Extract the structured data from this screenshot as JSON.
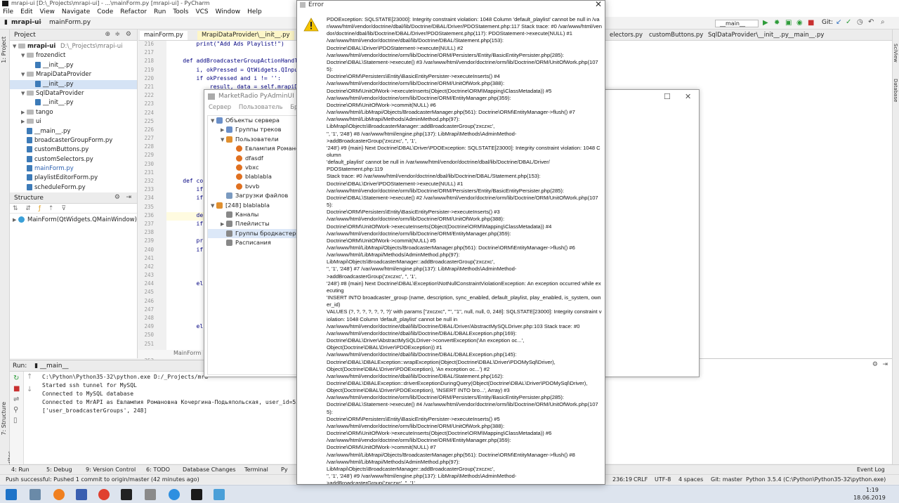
{
  "ide": {
    "title": "mrapi-ui [D:\\_Projects\\mrapi-ui] - ...\\mainForm.py [mrapi-ui] - PyCharm",
    "menu": [
      "File",
      "Edit",
      "View",
      "Navigate",
      "Code",
      "Refactor",
      "Run",
      "Tools",
      "VCS",
      "Window",
      "Help"
    ],
    "breadcrumb_project": "mrapi-ui",
    "breadcrumb_file": "mainForm.py",
    "run_config": "__main__",
    "git_label": "Git:"
  },
  "project_panel": {
    "title": "Project",
    "root": "mrapi-ui",
    "root_path": "D:\\_Projects\\mrapi-ui",
    "items": [
      {
        "label": "frozendict",
        "type": "folder"
      },
      {
        "label": "__init__.py",
        "type": "file"
      },
      {
        "label": "MrapiDataProvider",
        "type": "folder"
      },
      {
        "label": "__init__.py",
        "type": "file"
      },
      {
        "label": "SqlDataProvider",
        "type": "folder"
      },
      {
        "label": "__init__.py",
        "type": "file"
      },
      {
        "label": "tango",
        "type": "folder"
      },
      {
        "label": "ui",
        "type": "folder"
      },
      {
        "label": "__main__.py",
        "type": "file"
      },
      {
        "label": "broadcasterGroupForm.py",
        "type": "file"
      },
      {
        "label": "customButtons.py",
        "type": "file"
      },
      {
        "label": "customSelectors.py",
        "type": "file"
      },
      {
        "label": "mainForm.py",
        "type": "file"
      },
      {
        "label": "playlistEditorForm.py",
        "type": "file"
      },
      {
        "label": "scheduleForm.py",
        "type": "file"
      }
    ]
  },
  "structure_panel": {
    "title": "Structure",
    "item": "MainForm(QtWidgets.QMainWindow)"
  },
  "editor": {
    "tabs": [
      "mainForm.py",
      "MrapiDataProvider\\__init__.py"
    ],
    "line_numbers": [
      "216",
      "217",
      "218",
      "219",
      "220",
      "221",
      "222",
      "223",
      "224",
      "225",
      "226",
      "227",
      "228",
      "229",
      "230",
      "231",
      "232",
      "233",
      "234",
      "235",
      "236",
      "237",
      "238",
      "239",
      "240",
      "241",
      "242",
      "243",
      "244",
      "245",
      "246",
      "247",
      "248",
      "249",
      "250",
      "251",
      "252",
      "253"
    ],
    "lines": [
      "        print(\"Add Ads Playlist!\")",
      "",
      "    def addBroadcasterGroupActionHandl",
      "        i, okPressed = QtWidgets.QInpu",
      "        if okPressed and i != '':",
      "            result, data = self.mrapiD",
      "",
      "",
      "",
      "",
      "",
      "",
      "",
      "",
      "",
      "",
      "    def co",
      "        if",
      "        if",
      "",
      "        de",
      "        if",
      "",
      "        pr",
      "        if",
      "",
      "",
      "",
      "        el",
      "",
      "",
      "",
      "",
      "        el",
      "",
      "",
      "",
      ""
    ],
    "footer": "MainForm"
  },
  "right_tabs": [
    "electors.py",
    "customButtons.py",
    "SqlDataProvider\\__init__.py",
    "__main__.py"
  ],
  "right_strip_labels": [
    "SciView",
    "Database"
  ],
  "left_strip_labels": [
    "1: Project",
    "7: Structure",
    "2: Favorites"
  ],
  "run_panel": {
    "label": "Run:",
    "config": "__main__",
    "output": [
      "C:\\Python\\Python35-32\\python.exe D:/_Projects/mra",
      "Started ssh tunnel for MySQL",
      "Connected to MySQL database",
      "Connected to MrAPI as Евлампия Романовна Кочергина-Подьяпольская, user_id=55",
      "['user_broadcasterGroups', 248]"
    ]
  },
  "bottom_tabs": [
    "4: Run",
    "5: Debug",
    "9: Version Control",
    "6: TODO",
    "Database Changes",
    "Terminal",
    "Py"
  ],
  "event_log": "Event Log",
  "status": {
    "message": "Push successful: Pushed 1 commit to origin/master (42 minutes ago)",
    "position": "236:19",
    "line_sep": "CRLF",
    "encoding": "UTF-8",
    "indent": "4 spaces",
    "git": "Git: master",
    "interpreter": "Python 3.5.4 (C:\\Python\\Python35-32\\python.exe)"
  },
  "taskbar": {
    "time": "1:19",
    "date": "18.06.2019"
  },
  "pyadmin": {
    "title": "MarketRadio PyAdminUI",
    "menu": [
      "Сервер",
      "Пользователь",
      "Бродкас"
    ],
    "tree": [
      {
        "label": "Объекты сервера",
        "level": 0,
        "arrow": "v"
      },
      {
        "label": "Группы треков",
        "level": 1,
        "arrow": ">"
      },
      {
        "label": "Пользователи",
        "level": 1,
        "arrow": "v"
      },
      {
        "label": "Евлампия Романова",
        "level": 2,
        "arrow": ""
      },
      {
        "label": "dfasdf",
        "level": 2,
        "arrow": ""
      },
      {
        "label": "vbxc",
        "level": 2,
        "arrow": ""
      },
      {
        "label": "blablabla",
        "level": 2,
        "arrow": ""
      },
      {
        "label": "bvvb",
        "level": 2,
        "arrow": ""
      },
      {
        "label": "Загрузки файлов",
        "level": 1,
        "arrow": ""
      },
      {
        "label": "[248] blablabla",
        "level": 0,
        "arrow": "v"
      },
      {
        "label": "Каналы",
        "level": 1,
        "arrow": ""
      },
      {
        "label": "Плейлисты",
        "level": 1,
        "arrow": ">"
      },
      {
        "label": "Группы бродкастеров",
        "level": 1,
        "arrow": ""
      },
      {
        "label": "Расписания",
        "level": 1,
        "arrow": ""
      }
    ]
  },
  "error_dialog": {
    "title": "Error",
    "message": "PDOException: SQLSTATE[23000]: Integrity constraint violation: 1048 Column 'default_playlist' cannot be null in /var/www/html/vendor/doctrine/dbal/lib/Doctrine/DBAL/Driver/PDOStatement.php:117 Stack trace: #0 /var/www/html/vendor/doctrine/dbal/lib/Doctrine/DBAL/Driver/PDOStatement.php(117): PDOStatement->execute(NULL) #1\n/var/www/html/vendor/doctrine/dbal/lib/Doctrine/DBAL/Statement.php(153):\nDoctrine\\DBAL\\Driver\\PDOStatement->execute(NULL) #2\n/var/www/html/vendor/doctrine/orm/lib/Doctrine/ORM/Persisters/Entity/BasicEntityPersister.php(285):\nDoctrine\\DBAL\\Statement->execute() #3 /var/www/html/vendor/doctrine/orm/lib/Doctrine/ORM/UnitOfWork.php(1075):\nDoctrine\\ORM\\Persisters\\Entity\\BasicEntityPersister->executeInserts() #4\n/var/www/html/vendor/doctrine/orm/lib/Doctrine/ORM/UnitOfWork.php(388):\nDoctrine\\ORM\\UnitOfWork->executeInserts(Object(Doctrine\\ORM\\Mapping\\ClassMetadata)) #5\n/var/www/html/vendor/doctrine/orm/lib/Doctrine/ORM/EntityManager.php(359):\nDoctrine\\ORM\\UnitOfWork->commit(NULL) #6\n/var/www/html/LibMrapi/Objects/BroadcasterManager.php(561): Doctrine\\ORM\\EntityManager->flush() #7\n/var/www/html/LibMrapi/Methods/AdminMethod.php(97):\nLibMrapi\\Objects\\BroadcasterManager::addBroadcasterGroup('zxczxc',\n'', '1', '248') #8 /var/www/html/engine.php(137): LibMrapi\\Methods\\AdminMethod-\n>addBroadcasterGroup('zxczxc', '', '1',\n'248') #9 {main} Next Doctrine\\DBAL\\Driver\\PDOException: SQLSTATE[23000]: Integrity constraint violation: 1048 Column\n'default_playlist' cannot be null in /var/www/html/vendor/doctrine/dbal/lib/Doctrine/DBAL/Driver/\nPDOStatement.php:119\nStack trace: #0 /var/www/html/vendor/doctrine/dbal/lib/Doctrine/DBAL/Statement.php(153):\nDoctrine\\DBAL\\Driver\\PDOStatement->execute(NULL) #1\n/var/www/html/vendor/doctrine/orm/lib/Doctrine/ORM/Persisters/Entity/BasicEntityPersister.php(285):\nDoctrine\\DBAL\\Statement->execute() #2 /var/www/html/vendor/doctrine/orm/lib/Doctrine/ORM/UnitOfWork.php(1075):\nDoctrine\\ORM\\Persisters\\Entity\\BasicEntityPersister->executeInserts() #3\n/var/www/html/vendor/doctrine/orm/lib/Doctrine/ORM/UnitOfWork.php(388):\nDoctrine\\ORM\\UnitOfWork->executeInserts(Object(Doctrine\\ORM\\Mapping\\ClassMetadata)) #4\n/var/www/html/vendor/doctrine/orm/lib/Doctrine/ORM/EntityManager.php(359):\nDoctrine\\ORM\\UnitOfWork->commit(NULL) #5\n/var/www/html/LibMrapi/Objects/BroadcasterManager.php(561): Doctrine\\ORM\\EntityManager->flush() #6\n/var/www/html/LibMrapi/Methods/AdminMethod.php(97):\nLibMrapi\\Objects\\BroadcasterManager::addBroadcasterGroup('zxczxc',\n'', '1', '248') #7 /var/www/html/engine.php(137): LibMrapi\\Methods\\AdminMethod-\n>addBroadcasterGroup('zxczxc', '', '1',\n'248') #8 {main} Next Doctrine\\DBAL\\Exception\\NotNullConstraintViolationException: An exception occurred while executing\n'INSERT INTO broadcaster_group (name, description, sync_enabled, default_playlist, play_enabled, is_system, owner_id)\nVALUES (?, ?, ?, ?, ?, ?, ?)' with params [\"zxczxc\", \"\", \"1\", null, null, 0, 248]: SQLSTATE[23000]: Integrity constraint violation: 1048 Column 'default_playlist' cannot be null in\n/var/www/html/vendor/doctrine/dbal/lib/Doctrine/DBAL/Driver/AbstractMySQLDriver.php:103 Stack trace: #0\n/var/www/html/vendor/doctrine/dbal/lib/Doctrine/DBAL/DBALException.php(169):\nDoctrine\\DBAL\\Driver\\AbstractMySQLDriver->convertException('An exception oc...',\nObject(Doctrine\\DBAL\\Driver\\PDOException)) #1\n/var/www/html/vendor/doctrine/dbal/lib/Doctrine/DBAL/DBALException.php(145):\nDoctrine\\DBAL\\DBALException::wrapException(Object(Doctrine\\DBAL\\Driver\\PDOMySql\\Driver),\nObject(Doctrine\\DBAL\\Driver\\PDOException), 'An exception oc...') #2\n/var/www/html/vendor/doctrine/dbal/lib/Doctrine/DBAL/Statement.php(162):\nDoctrine\\DBAL\\DBALException::driverExceptionDuringQuery(Object(Doctrine\\DBAL\\Driver\\PDOMySql\\Driver),\nObject(Doctrine\\DBAL\\Driver\\PDOException), 'INSERT INTO bro...', Array) #3\n/var/www/html/vendor/doctrine/orm/lib/Doctrine/ORM/Persisters/Entity/BasicEntityPersister.php(285):\nDoctrine\\DBAL\\Statement->execute() #4 /var/www/html/vendor/doctrine/orm/lib/Doctrine/ORM/UnitOfWork.php(1075):\nDoctrine\\ORM\\Persisters\\Entity\\BasicEntityPersister->executeInserts() #5\n/var/www/html/vendor/doctrine/orm/lib/Doctrine/ORM/UnitOfWork.php(388):\nDoctrine\\ORM\\UnitOfWork->executeInserts(Object(Doctrine\\ORM\\Mapping\\ClassMetadata)) #6\n/var/www/html/vendor/doctrine/orm/lib/Doctrine/ORM/EntityManager.php(359):\nDoctrine\\ORM\\UnitOfWork->commit(NULL) #7\n/var/www/html/LibMrapi/Objects/BroadcasterManager.php(561): Doctrine\\ORM\\EntityManager->flush() #8\n/var/www/html/LibMrapi/Methods/AdminMethod.php(97):\nLibMrapi\\Objects\\BroadcasterManager::addBroadcasterGroup('zxczxc',\n'', '1', '248') #9 /var/www/html/engine.php(137): LibMrapi\\Methods\\AdminMethod-\n>addBroadcasterGroup('zxczxc', '', '1',"
  }
}
